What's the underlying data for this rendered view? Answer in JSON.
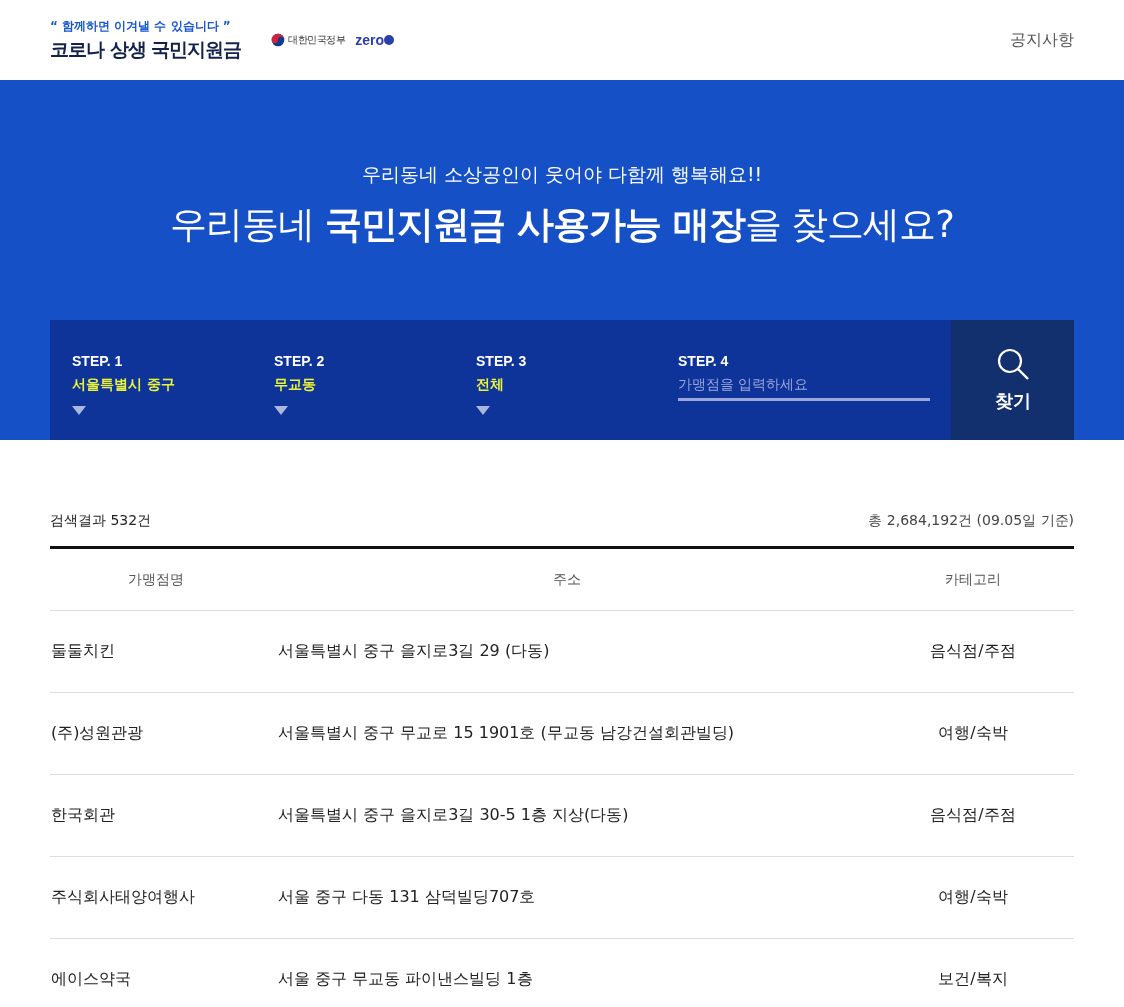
{
  "header": {
    "slogan": "“ 함께하면 이겨낼 수 있습니다 ”",
    "title": "코로나 상생 국민지원금",
    "gov_label": "대한민국정부",
    "zero_label": "zero",
    "nav": "공지사항"
  },
  "hero": {
    "subtitle": "우리동네 소상공인이 웃어야 다함께 행복해요!!",
    "headline": "우리동네 **국민지원금 사용가능 매장**을 찾으세요?"
  },
  "steps": [
    {
      "kind": "select",
      "label": "STEP. 1",
      "value": "서울특별시 중구"
    },
    {
      "kind": "select",
      "label": "STEP. 2",
      "value": "무교동"
    },
    {
      "kind": "select",
      "label": "STEP. 3",
      "value": "전체"
    },
    {
      "kind": "input",
      "label": "STEP. 4",
      "placeholder": "가맹점을 입력하세요"
    }
  ],
  "search_button": "찾기",
  "results": {
    "count": "검색결과 532건",
    "total": "총 2,684,192건 (09.05일 기준)"
  },
  "table": {
    "columns": [
      "가맹점명",
      "주소",
      "카테고리"
    ],
    "rows": [
      [
        "둘둘치킨",
        "서울특별시 중구 을지로3길 29 (다동)",
        "음식점/주점"
      ],
      [
        "(주)성원관광",
        "서울특별시 중구 무교로 15 1901호 (무교동 남강건설회관빌딩)",
        "여행/숙박"
      ],
      [
        "한국회관",
        "서울특별시 중구 을지로3길 30-5 1층 지상(다동)",
        "음식점/주점"
      ],
      [
        "주식회사태양여행사",
        "서울 중구 다동 131 삼덕빌딩707호",
        "여행/숙박"
      ],
      [
        "에이스약국",
        "서울 중구 무교동 파이낸스빌딩 1층",
        "보건/복지"
      ]
    ]
  }
}
